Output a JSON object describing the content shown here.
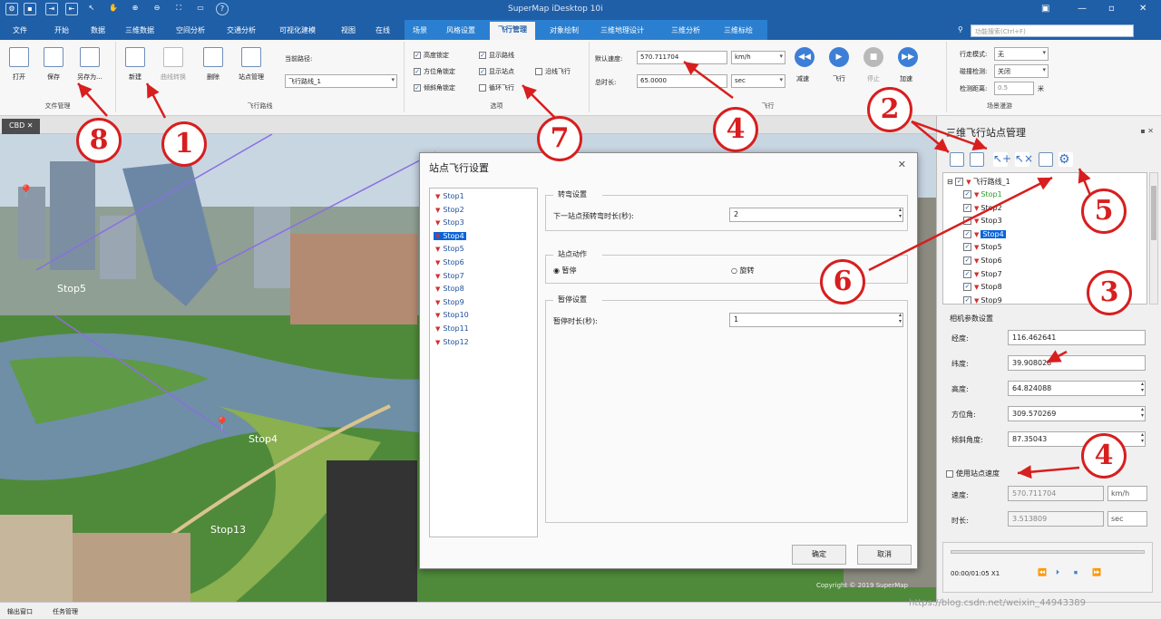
{
  "app_title": "SuperMap iDesktop 10i",
  "menu_tabs": [
    "文件",
    "开始",
    "数据",
    "三维数据",
    "空间分析",
    "交通分析",
    "可视化建模",
    "视图",
    "在线",
    "场景",
    "风格设置",
    "飞行管理",
    "对象绘制",
    "三维地理设计",
    "三维分析",
    "三维标绘"
  ],
  "active_tab": "飞行管理",
  "search_placeholder": "功能搜索(Ctrl+F)",
  "ribbon": {
    "file_group": {
      "label": "文件管理",
      "open": "打开",
      "save": "保存",
      "save_as": "另存为..."
    },
    "route_group": {
      "label": "飞行路线",
      "new": "新建",
      "curve": "曲线转换",
      "delete": "删除",
      "stop_manage": "站点管理",
      "current_route_label": "当前路径:",
      "current_route": "飞行路线_1"
    },
    "options": {
      "label": "选项",
      "height_lock": "高度锁定",
      "azimuth_lock": "方位角锁定",
      "tilt_lock": "倾斜角锁定",
      "show_route": "显示路线",
      "show_stops": "显示站点",
      "loop_fly": "循环飞行",
      "along_fly": "沿线飞行"
    },
    "fly": {
      "label": "飞行",
      "default_speed_label": "默认速度:",
      "default_speed": "570.711704",
      "speed_unit": "km/h",
      "total_time_label": "总时长:",
      "total_time": "65.0000",
      "time_unit": "sec",
      "slow": "减速",
      "fly": "飞行",
      "stop": "停止",
      "fast": "加速"
    },
    "roam": {
      "label": "场景漫游",
      "walk_mode_label": "行走模式:",
      "walk_mode": "无",
      "collision_label": "碰撞检测:",
      "collision": "关闭",
      "detect_distance_label": "检测距离:",
      "detect_distance": "0.5",
      "detect_unit": "米"
    }
  },
  "doc_tab": "CBD",
  "scene_labels": {
    "stop5": "Stop5",
    "stop4": "Stop4",
    "stop13": "Stop13",
    "copyright": "Copyright © 2019 SuperMap"
  },
  "dialog": {
    "title": "站点飞行设置",
    "stops": [
      "Stop1",
      "Stop2",
      "Stop3",
      "Stop4",
      "Stop5",
      "Stop6",
      "Stop7",
      "Stop8",
      "Stop9",
      "Stop10",
      "Stop11",
      "Stop12"
    ],
    "selected_stop": "Stop4",
    "turn_section": "转弯设置",
    "turn_label": "下一站点预转弯时长(秒):",
    "turn_value": "2",
    "action_section": "站点动作",
    "action_pause": "暂停",
    "action_rotate": "旋转",
    "pause_section": "暂停设置",
    "pause_label": "暂停时长(秒):",
    "pause_value": "1",
    "ok": "确定",
    "cancel": "取消"
  },
  "right_panel": {
    "title": "三维飞行站点管理",
    "tree_root": "飞行路线_1",
    "tree_items": [
      "Stop1",
      "Stop2",
      "Stop3",
      "Stop4",
      "Stop5",
      "Stop6",
      "Stop7",
      "Stop8",
      "Stop9"
    ],
    "camera_section": "相机参数设置",
    "lon_label": "经度:",
    "lon": "116.462641",
    "lat_label": "纬度:",
    "lat": "39.908028",
    "alt_label": "高度:",
    "alt": "64.824088",
    "azimuth_label": "方位角:",
    "azimuth": "309.570269",
    "tilt_label": "倾斜角度:",
    "tilt": "87.35043",
    "use_stop_speed": "使用站点速度",
    "speed_label": "速度:",
    "speed": "570.711704",
    "speed_unit": "km/h",
    "time_label": "时长:",
    "time": "3.513809",
    "time_unit": "sec",
    "player_time": "00:00/01:05 X1"
  },
  "status": {
    "output": "输出窗口",
    "tasks": "任务管理"
  },
  "watermark": "https://blog.csdn.net/weixin_44943389",
  "callouts": [
    "1",
    "2",
    "3",
    "4",
    "4",
    "5",
    "6",
    "7",
    "8"
  ],
  "colors": {
    "title_bar": "#1f5fa8",
    "callout": "#d81e1e",
    "selection": "#0a64d8"
  }
}
